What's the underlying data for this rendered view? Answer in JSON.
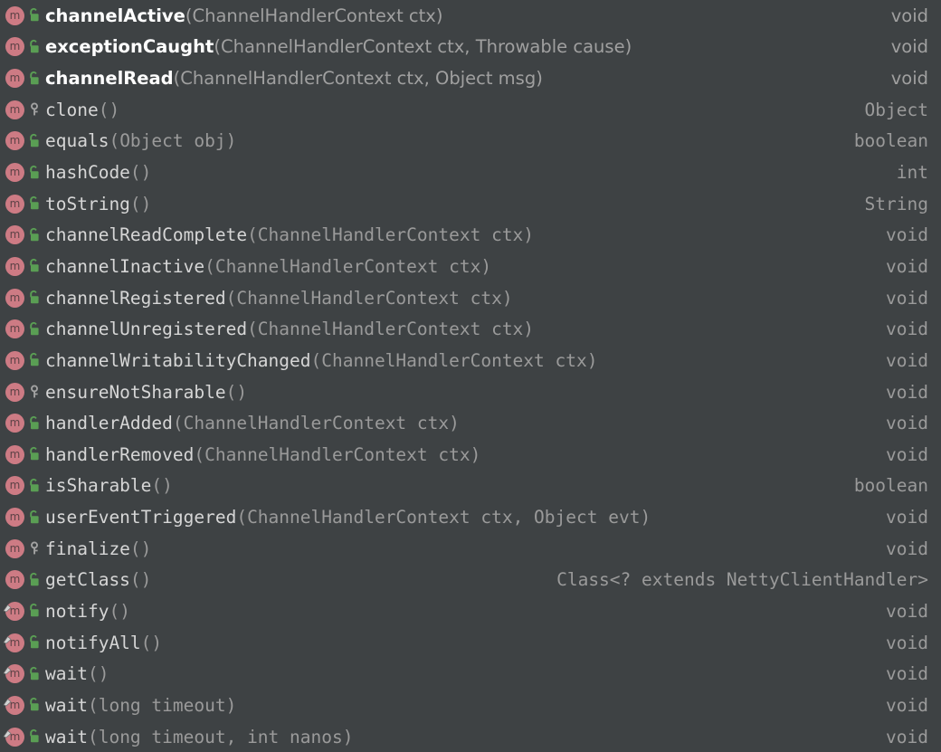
{
  "popup": {
    "kind": "code-completion-popup",
    "background_color": "#3e4244",
    "method_icon_color": "#cd7b84",
    "public_icon_color": "#5a9e54",
    "protected_icon_color": "#9a9a9a",
    "name_color": "#d6d6d6",
    "params_color": "#9a9a9a",
    "return_type_color": "#9a9a9a",
    "highlight_name_color": "#ffffff",
    "owner_class": "NettyClientHandler"
  },
  "rows": [
    {
      "icon": "method-icon",
      "visibility": "public",
      "visibility_icon": "unlocked-padlock-icon",
      "final": false,
      "bold": true,
      "name": "channelActive",
      "params": "(ChannelHandlerContext ctx)",
      "return_type": "void"
    },
    {
      "icon": "method-icon",
      "visibility": "public",
      "visibility_icon": "unlocked-padlock-icon",
      "final": false,
      "bold": true,
      "name": "exceptionCaught",
      "params": "(ChannelHandlerContext ctx, Throwable cause)",
      "return_type": "void"
    },
    {
      "icon": "method-icon",
      "visibility": "public",
      "visibility_icon": "unlocked-padlock-icon",
      "final": false,
      "bold": true,
      "name": "channelRead",
      "params": "(ChannelHandlerContext ctx, Object msg)",
      "return_type": "void"
    },
    {
      "icon": "method-icon",
      "visibility": "protected",
      "visibility_icon": "key-icon",
      "final": false,
      "bold": false,
      "name": "clone",
      "params": "()",
      "return_type": "Object"
    },
    {
      "icon": "method-icon",
      "visibility": "public",
      "visibility_icon": "unlocked-padlock-icon",
      "final": false,
      "bold": false,
      "name": "equals",
      "params": "(Object obj)",
      "return_type": "boolean"
    },
    {
      "icon": "method-icon",
      "visibility": "public",
      "visibility_icon": "unlocked-padlock-icon",
      "final": false,
      "bold": false,
      "name": "hashCode",
      "params": "()",
      "return_type": "int"
    },
    {
      "icon": "method-icon",
      "visibility": "public",
      "visibility_icon": "unlocked-padlock-icon",
      "final": false,
      "bold": false,
      "name": "toString",
      "params": "()",
      "return_type": "String"
    },
    {
      "icon": "method-icon",
      "visibility": "public",
      "visibility_icon": "unlocked-padlock-icon",
      "final": false,
      "bold": false,
      "name": "channelReadComplete",
      "params": "(ChannelHandlerContext ctx)",
      "return_type": "void"
    },
    {
      "icon": "method-icon",
      "visibility": "public",
      "visibility_icon": "unlocked-padlock-icon",
      "final": false,
      "bold": false,
      "name": "channelInactive",
      "params": "(ChannelHandlerContext ctx)",
      "return_type": "void"
    },
    {
      "icon": "method-icon",
      "visibility": "public",
      "visibility_icon": "unlocked-padlock-icon",
      "final": false,
      "bold": false,
      "name": "channelRegistered",
      "params": "(ChannelHandlerContext ctx)",
      "return_type": "void"
    },
    {
      "icon": "method-icon",
      "visibility": "public",
      "visibility_icon": "unlocked-padlock-icon",
      "final": false,
      "bold": false,
      "name": "channelUnregistered",
      "params": "(ChannelHandlerContext ctx)",
      "return_type": "void"
    },
    {
      "icon": "method-icon",
      "visibility": "public",
      "visibility_icon": "unlocked-padlock-icon",
      "final": false,
      "bold": false,
      "name": "channelWritabilityChanged",
      "params": "(ChannelHandlerContext ctx)",
      "return_type": "void"
    },
    {
      "icon": "method-icon",
      "visibility": "protected",
      "visibility_icon": "key-icon",
      "final": false,
      "bold": false,
      "name": "ensureNotSharable",
      "params": "()",
      "return_type": "void"
    },
    {
      "icon": "method-icon",
      "visibility": "public",
      "visibility_icon": "unlocked-padlock-icon",
      "final": false,
      "bold": false,
      "name": "handlerAdded",
      "params": "(ChannelHandlerContext ctx)",
      "return_type": "void"
    },
    {
      "icon": "method-icon",
      "visibility": "public",
      "visibility_icon": "unlocked-padlock-icon",
      "final": false,
      "bold": false,
      "name": "handlerRemoved",
      "params": "(ChannelHandlerContext ctx)",
      "return_type": "void"
    },
    {
      "icon": "method-icon",
      "visibility": "public",
      "visibility_icon": "unlocked-padlock-icon",
      "final": false,
      "bold": false,
      "name": "isSharable",
      "params": "()",
      "return_type": "boolean"
    },
    {
      "icon": "method-icon",
      "visibility": "public",
      "visibility_icon": "unlocked-padlock-icon",
      "final": false,
      "bold": false,
      "name": "userEventTriggered",
      "params": "(ChannelHandlerContext ctx, Object evt)",
      "return_type": "void"
    },
    {
      "icon": "method-icon",
      "visibility": "protected",
      "visibility_icon": "key-icon",
      "final": false,
      "bold": false,
      "name": "finalize",
      "params": "()",
      "return_type": "void"
    },
    {
      "icon": "method-icon",
      "visibility": "public",
      "visibility_icon": "unlocked-padlock-icon",
      "final": false,
      "bold": false,
      "name": "getClass",
      "params": "()",
      "return_type": "Class<? extends NettyClientHandler>"
    },
    {
      "icon": "method-icon",
      "visibility": "public",
      "visibility_icon": "unlocked-padlock-icon",
      "final": true,
      "bold": false,
      "name": "notify",
      "params": "()",
      "return_type": "void"
    },
    {
      "icon": "method-icon",
      "visibility": "public",
      "visibility_icon": "unlocked-padlock-icon",
      "final": true,
      "bold": false,
      "name": "notifyAll",
      "params": "()",
      "return_type": "void"
    },
    {
      "icon": "method-icon",
      "visibility": "public",
      "visibility_icon": "unlocked-padlock-icon",
      "final": true,
      "bold": false,
      "name": "wait",
      "params": "()",
      "return_type": "void"
    },
    {
      "icon": "method-icon",
      "visibility": "public",
      "visibility_icon": "unlocked-padlock-icon",
      "final": true,
      "bold": false,
      "name": "wait",
      "params": "(long timeout)",
      "return_type": "void"
    },
    {
      "icon": "method-icon",
      "visibility": "public",
      "visibility_icon": "unlocked-padlock-icon",
      "final": true,
      "bold": false,
      "name": "wait",
      "params": "(long timeout, int nanos)",
      "return_type": "void"
    }
  ]
}
